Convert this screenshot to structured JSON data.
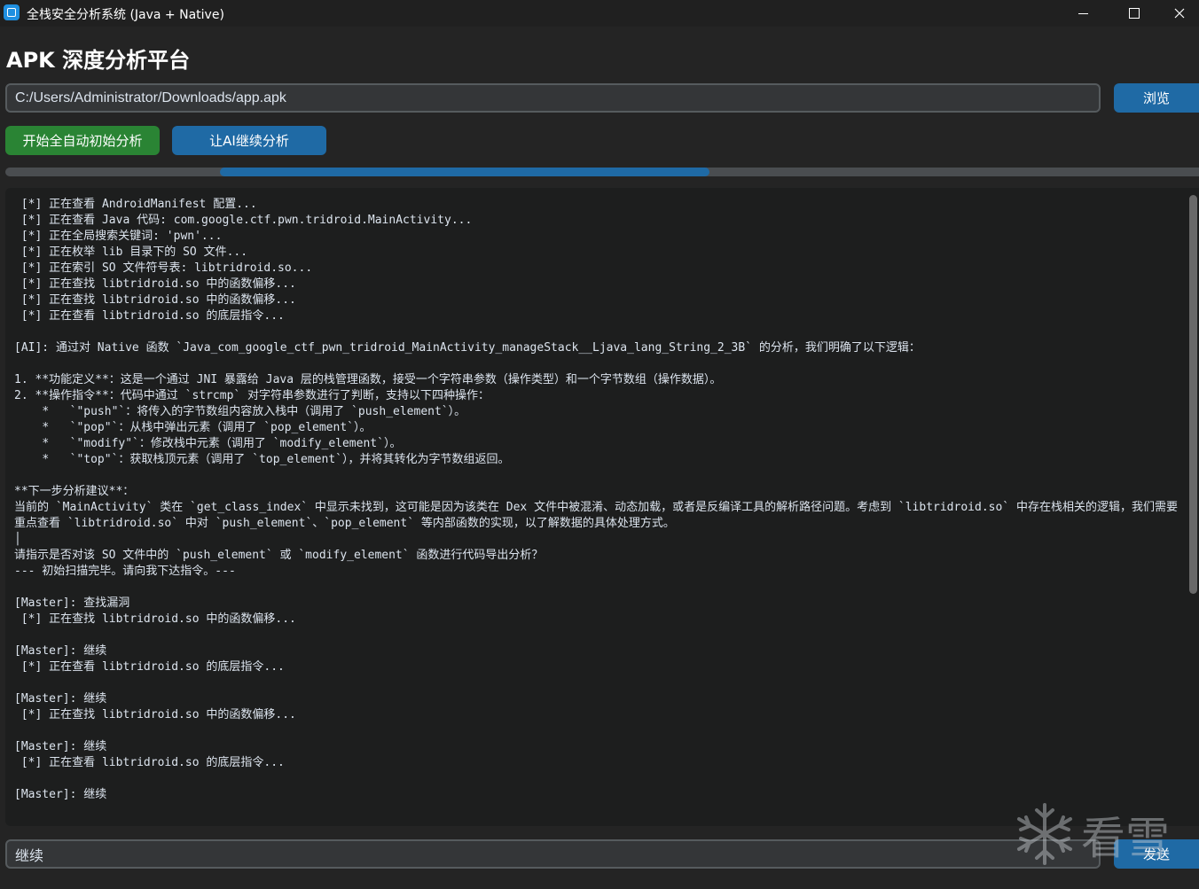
{
  "window": {
    "title": "全栈安全分析系统 (Java + Native)",
    "minimize_glyph": "—",
    "maximize_glyph": "□",
    "close_glyph": "✕"
  },
  "header": {
    "title": "APK 深度分析平台"
  },
  "file": {
    "path_value": "C:/Users/Administrator/Downloads/app.apk",
    "browse_label": "浏览"
  },
  "actions": {
    "start_label": "开始全自动初始分析",
    "ai_label": "让AI继续分析"
  },
  "progress": {
    "indeterminate": true,
    "segment_start": 0.18,
    "segment_end": 0.59,
    "accent": "#1f6aa5"
  },
  "log": {
    "lines": [
      " [*] 正在查看 AndroidManifest 配置...",
      " [*] 正在查看 Java 代码: com.google.ctf.pwn.tridroid.MainActivity...",
      " [*] 正在全局搜索关键词: 'pwn'...",
      " [*] 正在枚举 lib 目录下的 SO 文件...",
      " [*] 正在索引 SO 文件符号表: libtridroid.so...",
      " [*] 正在查找 libtridroid.so 中的函数偏移...",
      " [*] 正在查找 libtridroid.so 中的函数偏移...",
      " [*] 正在查看 libtridroid.so 的底层指令...",
      "",
      "[AI]: 通过对 Native 函数 `Java_com_google_ctf_pwn_tridroid_MainActivity_manageStack__Ljava_lang_String_2_3B` 的分析，我们明确了以下逻辑：",
      "",
      "1. **功能定义**：这是一个通过 JNI 暴露给 Java 层的栈管理函数，接受一个字符串参数（操作类型）和一个字节数组（操作数据）。",
      "2. **操作指令**：代码中通过 `strcmp` 对字符串参数进行了判断，支持以下四种操作：",
      "    *   `\"push\"`：将传入的字节数组内容放入栈中（调用了 `push_element`）。",
      "    *   `\"pop\"`：从栈中弹出元素（调用了 `pop_element`）。",
      "    *   `\"modify\"`：修改栈中元素（调用了 `modify_element`）。",
      "    *   `\"top\"`：获取栈顶元素（调用了 `top_element`），并将其转化为字节数组返回。",
      "",
      "**下一步分析建议**：",
      "当前的 `MainActivity` 类在 `get_class_index` 中显示未找到，这可能是因为该类在 Dex 文件中被混淆、动态加载，或者是反编译工具的解析路径问题。考虑到 `libtridroid.so` 中存在栈相关的逻辑，我们需要重点查看 `libtridroid.so` 中对 `push_element`、`pop_element` 等内部函数的实现，以了解数据的具体处理方式。",
      "│",
      "请指示是否对该 SO 文件中的 `push_element` 或 `modify_element` 函数进行代码导出分析？",
      "--- 初始扫描完毕。请向我下达指令。---",
      "",
      "[Master]: 查找漏洞",
      " [*] 正在查找 libtridroid.so 中的函数偏移...",
      "",
      "[Master]: 继续",
      " [*] 正在查看 libtridroid.so 的底层指令...",
      "",
      "[Master]: 继续",
      " [*] 正在查找 libtridroid.so 中的函数偏移...",
      "",
      "[Master]: 继续",
      " [*] 正在查看 libtridroid.so 的底层指令...",
      "",
      "[Master]: 继续"
    ]
  },
  "command": {
    "input_value": "继续",
    "send_label": "发送"
  },
  "watermark": {
    "text": "看雪",
    "icon": "snowflake-icon"
  },
  "colors": {
    "background": "#242424",
    "titlebar": "#202020",
    "log_bg": "#1d1e1e",
    "primary_button": "#1f6aa5",
    "start_button": "#2a8434",
    "text": "#dce4ee"
  }
}
